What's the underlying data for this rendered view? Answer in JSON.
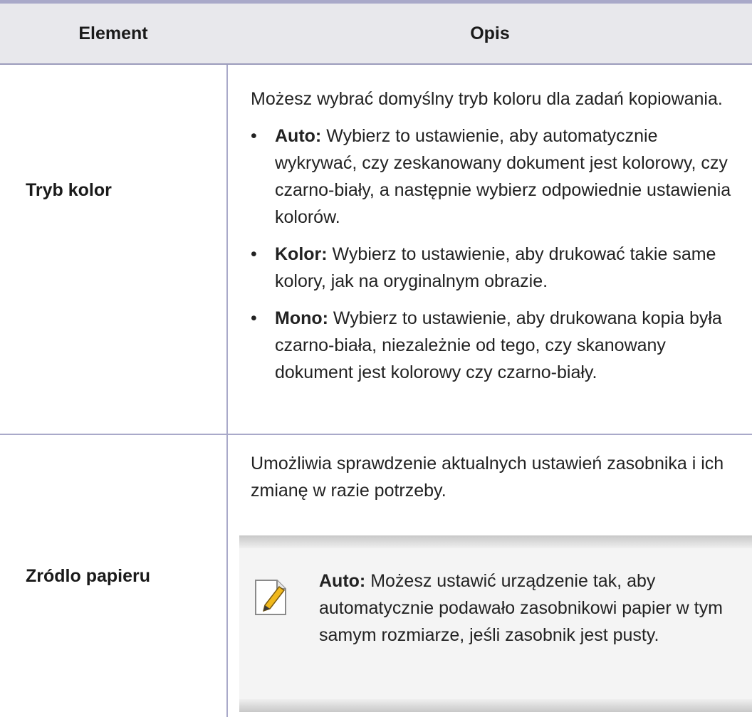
{
  "table": {
    "headers": {
      "element": "Element",
      "description": "Opis"
    },
    "rows": [
      {
        "element": "Tryb kolor",
        "intro": "Możesz wybrać domyślny tryb koloru dla zadań kopiowania.",
        "bullets": [
          {
            "marker": "•",
            "term": "Auto:",
            "text": " Wybierz to ustawienie, aby automatycznie wykrywać, czy zeskanowany dokument jest kolorowy, czy czarno-biały, a następnie wybierz odpowiednie ustawienia kolorów."
          },
          {
            "marker": "•",
            "term": "Kolor:",
            "text": " Wybierz to ustawienie, aby drukować takie same kolory, jak na oryginalnym obrazie."
          },
          {
            "marker": "•",
            "term": "Mono:",
            "text": " Wybierz to ustawienie, aby drukowana kopia była czarno-biała, niezależnie od tego, czy skanowany dokument jest kolorowy czy czarno-biały."
          }
        ]
      },
      {
        "element": "Zródlo papieru",
        "intro": "Umożliwia sprawdzenie aktualnych ustawień zasobnika i ich zmianę w razie potrzeby.",
        "note": {
          "icon": "note-pencil-icon",
          "term": "Auto:",
          "text": " Możesz ustawić urządzenie tak, aby automatycznie podawało zasobnikowi papier w tym samym rozmiarze, jeśli zasobnik jest pusty."
        }
      }
    ]
  },
  "colors": {
    "rule": "#a9a9c9",
    "header_bg": "#e8e8ec",
    "note_bg": "#f4f4f4",
    "icon_accent": "#f0b81c"
  }
}
